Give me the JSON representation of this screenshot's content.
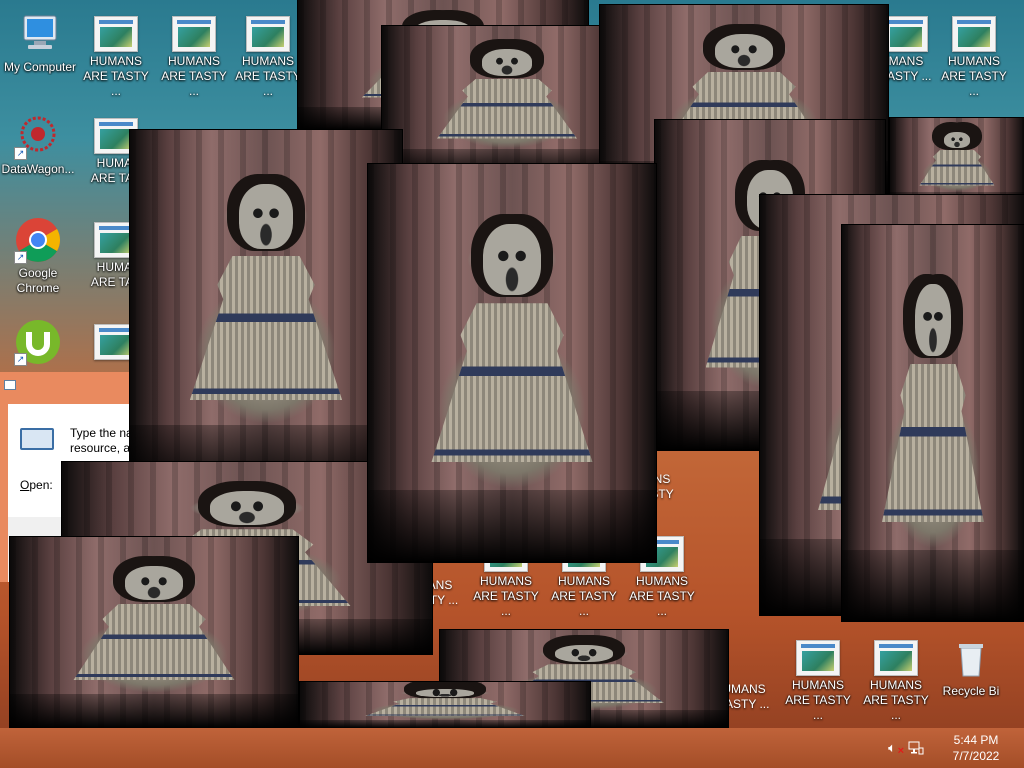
{
  "desktop": {
    "icons": [
      {
        "label": "My Computer",
        "kind": "computer-icon"
      },
      {
        "label": "DataWagon...",
        "kind": "datawagon-icon"
      },
      {
        "label": "Google Chrome",
        "kind": "chrome-icon"
      },
      {
        "label": "",
        "kind": "utorrent-icon"
      },
      {
        "label": "HUMANS ARE TASTY ...",
        "kind": "file-icon"
      },
      {
        "label": "Recycle Bi",
        "kind": "recycle-bin-icon"
      }
    ],
    "file_label": "HUMANS ARE TASTY ...",
    "file_label_line1": "HUMANS",
    "file_label_line2": "ARE TASTY ...",
    "file_label_cut1": "HUMAI",
    "file_label_cut2": "ARE TAS",
    "file_label_cut3": "MANS",
    "file_label_cut4": "TASTY ...",
    "file_label_cut5": "ANS",
    "file_label_cut6": "STY ...",
    "file_label_cut7": "UMANS",
    "file_label_cut8": "TASTY ...",
    "file_label_cut9": "ASTY",
    "file_label_cut10": "ANS",
    "file_label_cut11": "STY ..."
  },
  "run_dialog": {
    "text_line1": "Type the na",
    "text_line2": "resource, a",
    "open_label": "Open:",
    "open_mnemonic": "O",
    "open_rest": "pen:"
  },
  "taskbar": {
    "time": "5:44 PM",
    "date": "7/7/2022"
  },
  "colors": {
    "taskbar": "#b5532a",
    "desktop_top": "#2a7a8f",
    "desktop_bottom": "#b5532a"
  }
}
